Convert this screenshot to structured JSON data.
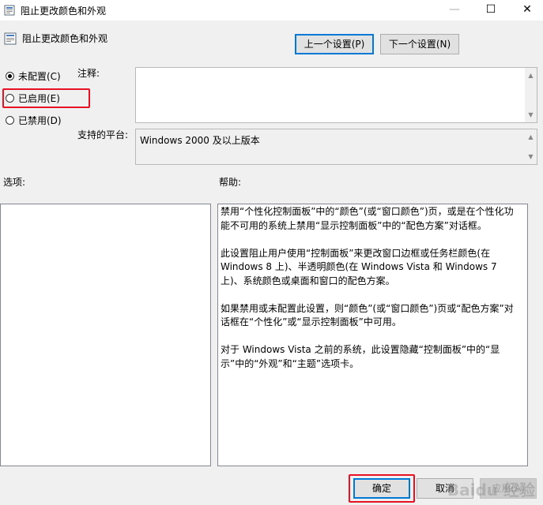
{
  "window": {
    "title": "阻止更改颜色和外观",
    "min_glyph": "—",
    "max_glyph": "☐",
    "close_glyph": "✕"
  },
  "header": {
    "setting_name": "阻止更改颜色和外观",
    "prev_button": "上一个设置(P)",
    "next_button": "下一个设置(N)"
  },
  "options_radio": [
    {
      "label": "未配置(C)",
      "checked": true
    },
    {
      "label": "已启用(E)",
      "checked": false
    },
    {
      "label": "已禁用(D)",
      "checked": false
    }
  ],
  "comment": {
    "label": "注释:",
    "value": ""
  },
  "platform": {
    "label": "支持的平台:",
    "value": "Windows 2000 及以上版本"
  },
  "options_label": "选项:",
  "help_label": "帮助:",
  "help_paragraphs": [
    "禁用“个性化控制面板”中的“颜色”(或“窗口颜色”)页，或是在个性化功能不可用的系统上禁用“显示控制面板”中的“配色方案”对话框。",
    "此设置阻止用户使用“控制面板”来更改窗口边框或任务栏颜色(在 Windows 8 上)、半透明颜色(在 Windows Vista 和 Windows 7 上)、系统颜色或桌面和窗口的配色方案。",
    "如果禁用或未配置此设置，则“颜色”(或“窗口颜色”)页或“配色方案”对话框在“个性化”或“显示控制面板”中可用。",
    "对于 Windows Vista 之前的系统，此设置隐藏“控制面板”中的“显示”中的“外观”和“主题”选项卡。"
  ],
  "footer": {
    "ok_button": "确定",
    "cancel_button": "取消",
    "apply_button": "应用(A)"
  },
  "watermark": "Baidu 经验",
  "colors": {
    "accent": "#0078d7",
    "highlight": "#e81123"
  }
}
